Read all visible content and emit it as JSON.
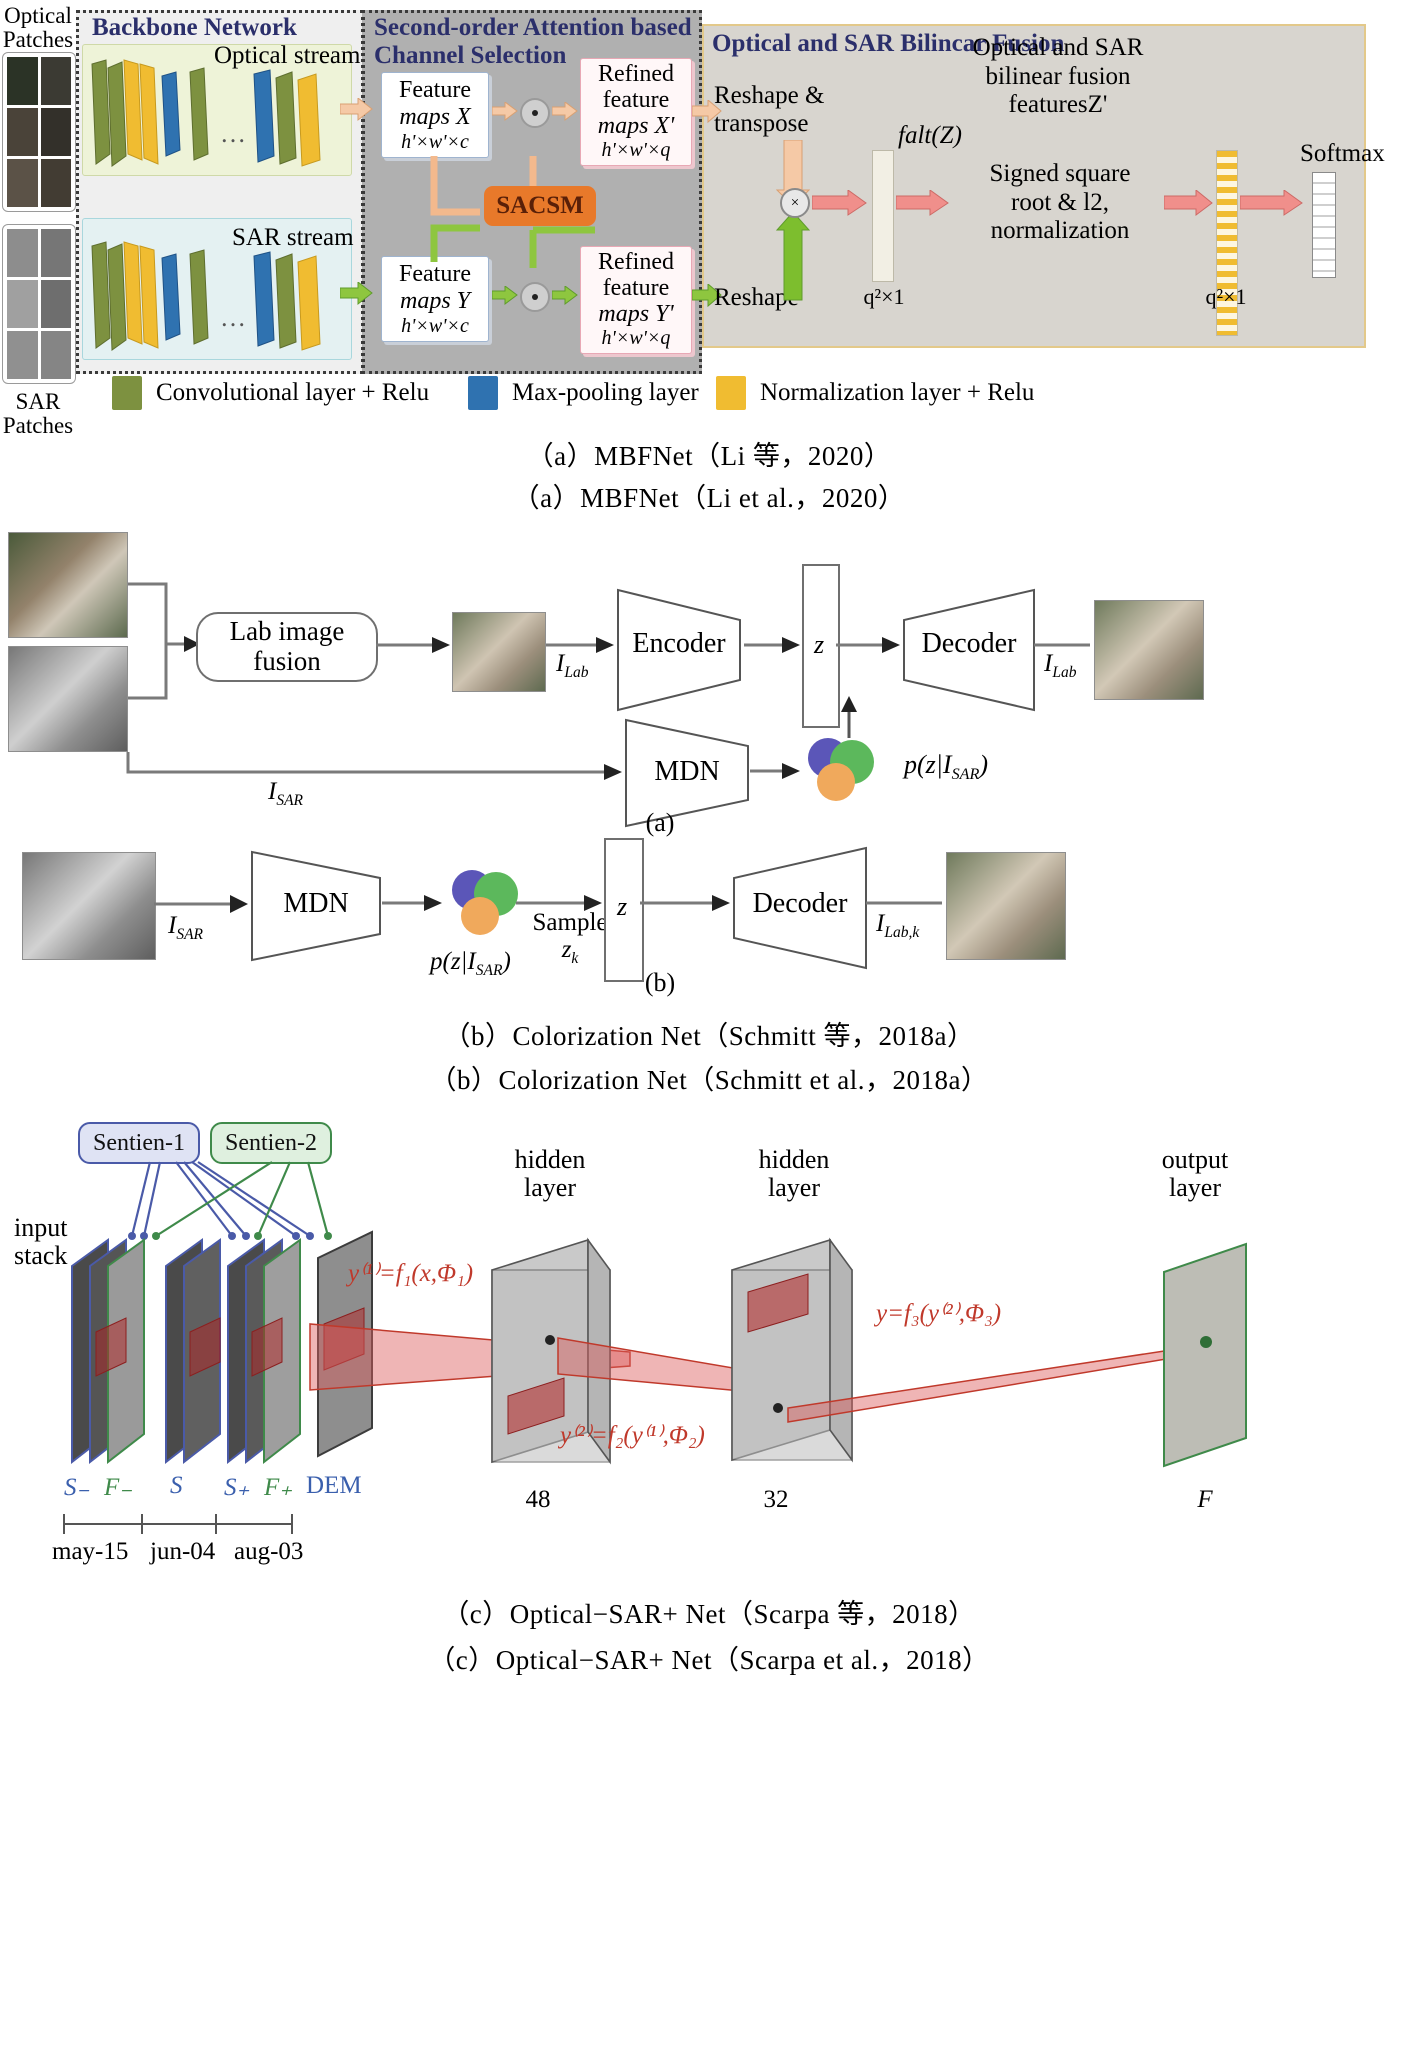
{
  "figure": {
    "panels": [
      {
        "id": "a",
        "caption_cn": "（a）MBFNet（Li 等，2020）",
        "caption_en": "（a）MBFNet（Li et al.，2020）"
      },
      {
        "id": "b",
        "caption_cn": "（b）Colorization Net（Schmitt 等，2018a）",
        "caption_en": "（b）Colorization Net（Schmitt et al.，2018a）"
      },
      {
        "id": "c",
        "caption_cn": "（c）Optical−SAR+ Net（Scarpa 等，2018）",
        "caption_en": "（c）Optical−SAR+ Net（Scarpa et al.，2018）"
      }
    ]
  },
  "panel_a": {
    "inputs": {
      "optical_label_l1": "Optical",
      "optical_label_l2": "Patches",
      "sar_label_l1": "SAR",
      "sar_label_l2": "Patches"
    },
    "backbone": {
      "title": "Backbone Network",
      "optical_stream": "Optical stream",
      "sar_stream": "SAR stream",
      "ellipsis": "…"
    },
    "attention": {
      "title_l1": "Second-order Attention based",
      "title_l2": "Channel Selection",
      "feature_x": {
        "l1": "Feature",
        "l2": "maps X",
        "dims": "h'×w'×c"
      },
      "feature_y": {
        "l1": "Feature",
        "l2": "maps Y",
        "dims": "h'×w'×c"
      },
      "refined_x": {
        "l1": "Refined",
        "l2": "feature",
        "l3": "maps X'",
        "dims": "h'×w'×q"
      },
      "refined_y": {
        "l1": "Refined",
        "l2": "feature",
        "l3": "maps Y'",
        "dims": "h'×w'×q"
      },
      "module": "SACSM",
      "op_symbol": "⊙"
    },
    "fusion": {
      "title": "Optical and SAR Bilincar Fusion",
      "reshape_transpose_l1": "Reshape &",
      "reshape_transpose_l2": "transpose",
      "reshape": "Reshape",
      "flat_z": "falt(Z)",
      "feat_title_l1": "Optical and SAR",
      "feat_title_l2": "bilinear fusion",
      "feat_title_l3": "featuresZ'",
      "signed_l1": "Signed square",
      "signed_l2": "root & l2,",
      "signed_l3": "normalization",
      "dim_left": "q²×1",
      "dim_right": "q²×1",
      "multiply_symbol": "×",
      "softmax": "Softmax"
    },
    "legend": [
      {
        "label": "Convolutional layer + Relu",
        "color": "#7d9140"
      },
      {
        "label": "Max-pooling layer",
        "color": "#2f72b0"
      },
      {
        "label": "Normalization layer + Relu",
        "color": "#f0bc31"
      }
    ]
  },
  "panel_b": {
    "sub_a_label": "(a)",
    "sub_b_label": "(b)",
    "lab_fusion_l1": "Lab image",
    "lab_fusion_l2": "fusion",
    "encoder": "Encoder",
    "decoder": "Decoder",
    "mdn": "MDN",
    "latent": "z",
    "i_lab": "I",
    "i_lab_sub": "Lab",
    "i_lab_k_sub": "Lab,k",
    "i_sar": "I",
    "i_sar_sub": "SAR",
    "posterior": "p(z|I",
    "posterior_sub": "SAR",
    "posterior_end": ")",
    "sample_l1": "Sample",
    "sample_l2": "z",
    "sample_l2_sub": "k"
  },
  "panel_c": {
    "sentinel_1": "Sentien-1",
    "sentinel_2": "Sentien-2",
    "input_stack_l1": "input",
    "input_stack_l2": "stack",
    "hidden_layer_1_l1": "hidden",
    "hidden_layer_1_l2": "layer",
    "hidden_layer_2_l1": "hidden",
    "hidden_layer_2_l2": "layer",
    "output_layer_l1": "output",
    "output_layer_l2": "layer",
    "band_labels": [
      "S₋",
      "F₋",
      "S",
      "S₊",
      "F₊",
      "DEM"
    ],
    "dates": [
      "may-15",
      "jun-04",
      "aug-03"
    ],
    "hidden_size_1": "48",
    "hidden_size_2": "32",
    "output_label": "F",
    "eq1": "y⁽¹⁾=f₁(x,Φ₁)",
    "eq2": "y⁽²⁾=f₂(y⁽¹⁾,Φ₂)",
    "eq3": "y=f₃(y⁽²⁾,Φ₃)"
  }
}
